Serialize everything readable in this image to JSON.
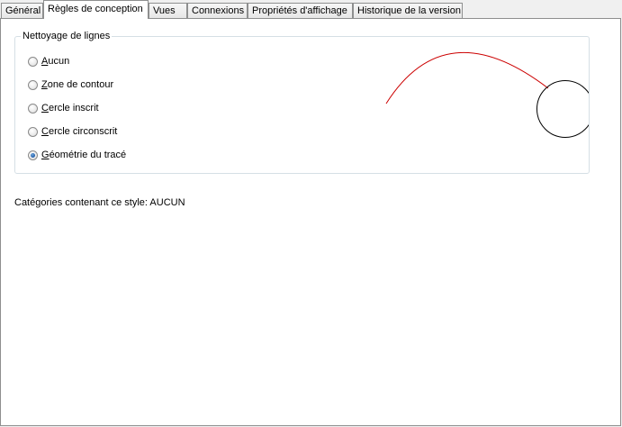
{
  "tabs": [
    {
      "label": "Général",
      "active": false
    },
    {
      "label": "Règles de conception",
      "active": true
    },
    {
      "label": "Vues",
      "active": false
    },
    {
      "label": "Connexions",
      "active": false
    },
    {
      "label": "Propriétés d'affichage",
      "active": false
    },
    {
      "label": "Historique de la version",
      "active": false
    }
  ],
  "cleanup_group": {
    "title": "Nettoyage de lignes",
    "options": [
      {
        "mnemonic": "A",
        "rest": "ucun",
        "checked": false
      },
      {
        "mnemonic": "Z",
        "rest": "one de contour",
        "checked": false
      },
      {
        "mnemonic": "C",
        "rest": "ercle inscrit",
        "checked": false
      },
      {
        "mnemonic": "C",
        "rest": "ercle circonscrit",
        "checked": false
      },
      {
        "mnemonic": "G",
        "rest": "éométrie du tracé",
        "checked": true
      }
    ]
  },
  "preview": {
    "arc_color": "#cc0000",
    "circle_color": "#000000"
  },
  "categories_text": "Catégories contenant ce style: AUCUN"
}
